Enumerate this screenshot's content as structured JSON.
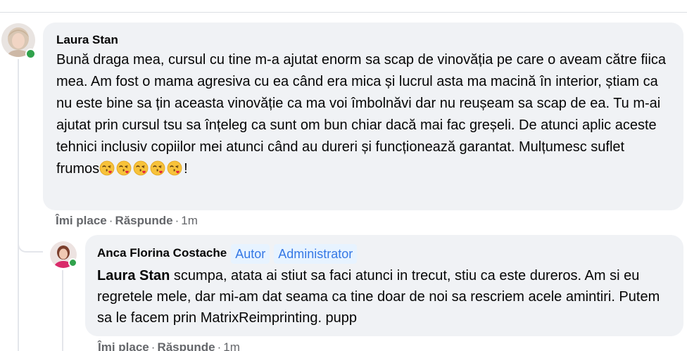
{
  "comments": [
    {
      "author": "Laura Stan",
      "text_main": "Bună draga mea, cursul cu tine m-a ajutat enorm sa scap de vinovăția pe care o aveam către fiica mea. Am fost o mama agresiva cu ea când era mica și lucrul asta ma macină în interior, știam ca nu este bine sa țin aceasta vinovăție ca ma voi îmbolnăvi dar nu reușeam sa scap de ea. Tu m-ai ajutat prin cursul tsu sa înțeleg ca sunt om bun chiar dacă mai fac greșeli. De atunci aplic aceste tehnici inclusiv copiilor mei atunci când au dureri și funcționează garantat. Mulțumesc suflet frumos",
      "text_end": "!",
      "emoji": "face-blowing-a-kiss",
      "emoji_count": 5,
      "like_label": "Îmi place",
      "reply_label": "Răspunde",
      "time": "1m",
      "online": true
    },
    {
      "author": "Anca Florina Costache",
      "badges": [
        "Autor",
        "Administrator"
      ],
      "mention": "Laura Stan",
      "text": " scumpa, atata ai stiut sa faci atunci in trecut, stiu ca este dureros. Am si eu regretele mele, dar mi-am dat seama ca tine doar de noi sa rescriem acele amintiri. Putem sa le facem prin MatrixReimprinting. pupp",
      "like_label": "Îmi place",
      "reply_label": "Răspunde",
      "time": "1m",
      "online": true
    }
  ],
  "separator": "·",
  "colors": {
    "bubble": "#f0f2f5",
    "meta_text": "#65676b",
    "badge_bg": "#e7f3ff",
    "badge_text": "#3578e5",
    "online": "#31a24c"
  }
}
